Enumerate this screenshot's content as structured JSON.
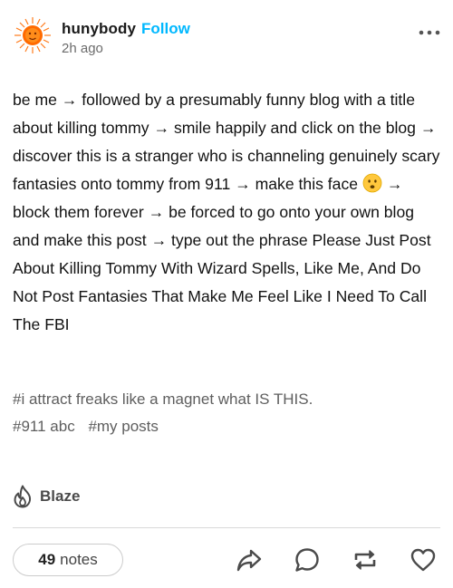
{
  "header": {
    "blog_name": "hunybody",
    "follow_label": "Follow",
    "timestamp": "2h ago",
    "avatar_icon": "sun-avatar-icon",
    "more_icon": "more-options-icon"
  },
  "post": {
    "segments": {
      "s1": "be me ",
      "s2": " followed by a presumably funny blog with a title about killing tommy ",
      "s3": " smile happily and click on the blog ",
      "s4": " discover this is a stranger who is channeling genuinely scary fantasies onto tommy from 911 ",
      "s5": " make this face ",
      "s6": " ",
      "s7": " block them forever ",
      "s8": " be forced to go onto your own blog and make this post ",
      "s9": " type out the phrase Please Just Post About Killing Tommy With Wizard Spells, Like Me, And Do Not Post Fantasies That Make Me Feel Like I Need To Call The FBI"
    },
    "arrow": "→",
    "emoji_icon": "frowning-face-emoji-icon"
  },
  "tags": [
    "#i attract freaks like a magnet what IS THIS.",
    "#911 abc",
    "#my posts"
  ],
  "blaze": {
    "label": "Blaze",
    "icon": "flame-icon"
  },
  "footer": {
    "notes_count": "49",
    "notes_label": "notes",
    "actions": [
      "share-icon",
      "reply-icon",
      "reblog-icon",
      "like-icon"
    ]
  },
  "colors": {
    "follow": "#00b8ff",
    "avatar_sun": "#ff6a00",
    "emoji_face": "#ffc83d"
  }
}
